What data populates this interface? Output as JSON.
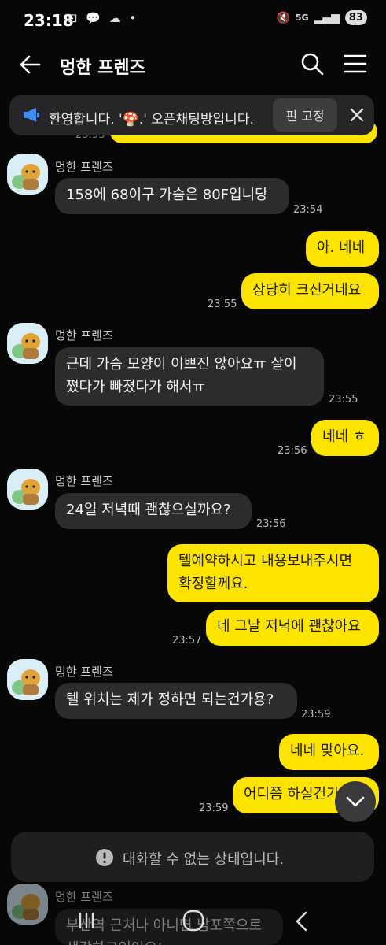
{
  "status": {
    "time": "23:18",
    "network": "5G",
    "battery": "83"
  },
  "header": {
    "title": "멍한 프렌즈"
  },
  "notice": {
    "text": "환영합니다. '🍄.' 오픈채팅방입니다.",
    "pin_label": "핀 고정"
  },
  "messages": {
    "m1": {
      "sender": "멍한 프렌즈",
      "text": "158에 68이구 가슴은 80F입니당",
      "time": "23:54"
    },
    "m2": {
      "text": "아. 네네"
    },
    "m3": {
      "text": "상당히 크신거네요",
      "time": "23:55"
    },
    "m4": {
      "sender": "멍한 프렌즈",
      "line1": "근데 가슴 모양이 이쁘진 않아요ㅠ 살이",
      "line2": "쪘다가 빠졌다가 해서ㅠ",
      "time": "23:55"
    },
    "m5": {
      "text": "네네 ㅎ",
      "time": "23:56"
    },
    "m6": {
      "sender": "멍한 프렌즈",
      "text": "24일 저녁때 괜찮으실까요?",
      "time": "23:56"
    },
    "m7": {
      "line1": "텔예약하시고 내용보내주시면",
      "line2": "확정할께요."
    },
    "m8": {
      "text": "네 그날 저녁에 괜찮아요",
      "time": "23:57"
    },
    "m9": {
      "sender": "멍한 프렌즈",
      "text": "텔 위치는 제가 정하면 되는건가용?",
      "time": "23:59"
    },
    "m10": {
      "text": "네네 맞아요."
    },
    "m11": {
      "text": "어디쯤 하실건가",
      "time": "23:59"
    },
    "m12": {
      "sender": "멍한 프렌즈",
      "line1": "부산역 근처나 아니면 남포쪽으로",
      "line2": "생각하고있어요!"
    }
  },
  "bottom": {
    "notice": "대화할 수 없는 상태입니다."
  },
  "colors": {
    "outgoing": "#fde400",
    "incoming": "#2c2c2e",
    "background": "#070707"
  }
}
